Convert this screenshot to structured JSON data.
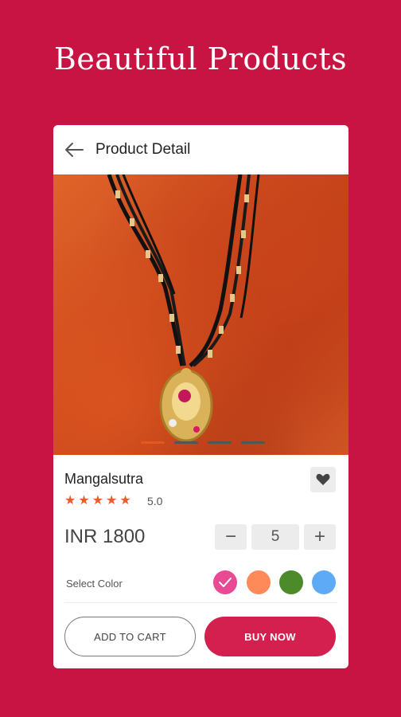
{
  "banner": {
    "title": "Beautiful Products"
  },
  "header": {
    "title": "Product Detail",
    "back_icon": "arrow-left-icon"
  },
  "gallery": {
    "slide_count": 4,
    "active_index": 0,
    "active_color": "#e05a1e"
  },
  "product": {
    "name": "Mangalsutra",
    "rating": "5.0",
    "stars": 5,
    "price": "INR 1800",
    "favorite_icon": "heart-icon"
  },
  "quantity": {
    "minus": "−",
    "value": "5",
    "plus": "+"
  },
  "colors": {
    "label": "Select Color",
    "options": [
      {
        "hex": "#e84a93",
        "selected": true
      },
      {
        "hex": "#fe8a5a",
        "selected": false
      },
      {
        "hex": "#4c8a2a",
        "selected": false
      },
      {
        "hex": "#5eaaf6",
        "selected": false
      }
    ]
  },
  "actions": {
    "add_to_cart": "ADD TO CART",
    "buy_now": "BUY NOW"
  },
  "theme": {
    "background": "#c81443",
    "accent": "#d3204e",
    "star": "#f05a28"
  }
}
